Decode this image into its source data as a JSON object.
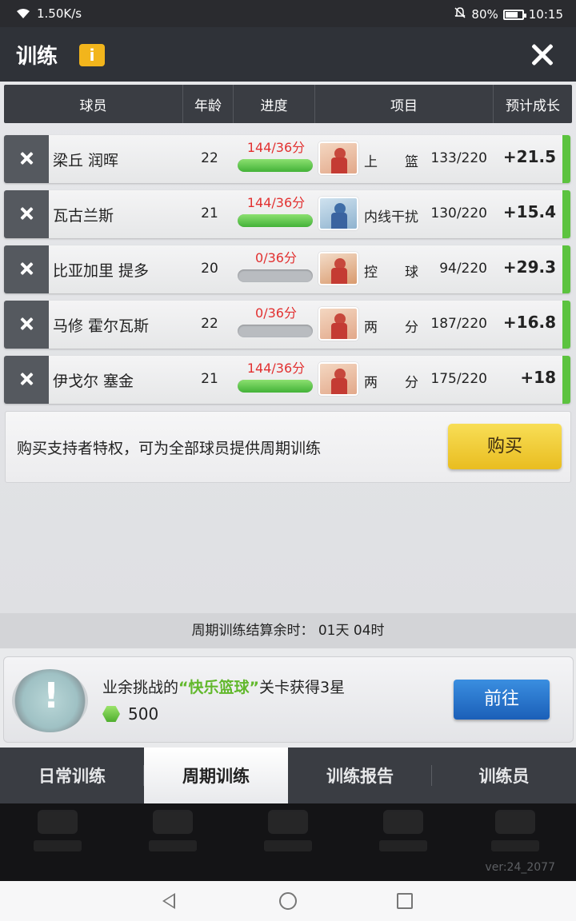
{
  "status_bar": {
    "speed": "1.50K/s",
    "battery": "80%",
    "time": "10:15"
  },
  "header": {
    "title": "训练",
    "info_badge": "i"
  },
  "table": {
    "columns": [
      "球员",
      "年龄",
      "进度",
      "项目",
      "预计成长"
    ],
    "rows": [
      {
        "name": "梁丘 润晖",
        "age": "22",
        "progress": "144/36分",
        "progress_fraction": 1.0,
        "item_label": "上　　篮",
        "item_value": "133/220",
        "growth": "+21.5"
      },
      {
        "name": "瓦古兰斯",
        "age": "21",
        "progress": "144/36分",
        "progress_fraction": 1.0,
        "item_label": "内线干扰",
        "item_value": "130/220",
        "growth": "+15.4"
      },
      {
        "name": "比亚加里 提多",
        "age": "20",
        "progress": "0/36分",
        "progress_fraction": 0.0,
        "item_label": "控　　球",
        "item_value": "94/220",
        "growth": "+29.3"
      },
      {
        "name": "马修 霍尔瓦斯",
        "age": "22",
        "progress": "0/36分",
        "progress_fraction": 0.0,
        "item_label": "两　　分",
        "item_value": "187/220",
        "growth": "+16.8"
      },
      {
        "name": "伊戈尔 塞金",
        "age": "21",
        "progress": "144/36分",
        "progress_fraction": 1.0,
        "item_label": "两　　分",
        "item_value": "175/220",
        "growth": "+18"
      }
    ]
  },
  "promo": {
    "text": "购买支持者特权，可为全部球员提供周期训练",
    "button": "购买"
  },
  "countdown": "周期训练结算余时：  01天 04时",
  "task": {
    "desc_prefix": "业余挑战的",
    "desc_highlight": "“快乐篮球”",
    "desc_suffix": "关卡获得3星",
    "reward": "500",
    "button": "前往"
  },
  "tabs": [
    {
      "label": "日常训练",
      "active": false
    },
    {
      "label": "周期训练",
      "active": true
    },
    {
      "label": "训练报告",
      "active": false
    },
    {
      "label": "训练员",
      "active": false
    }
  ],
  "version": "ver:24_2077",
  "colors": {
    "accent_green": "#5cc33f",
    "progress_red": "#e23030",
    "buy_yellow": "#f0cc38",
    "go_blue": "#2a76cc"
  }
}
